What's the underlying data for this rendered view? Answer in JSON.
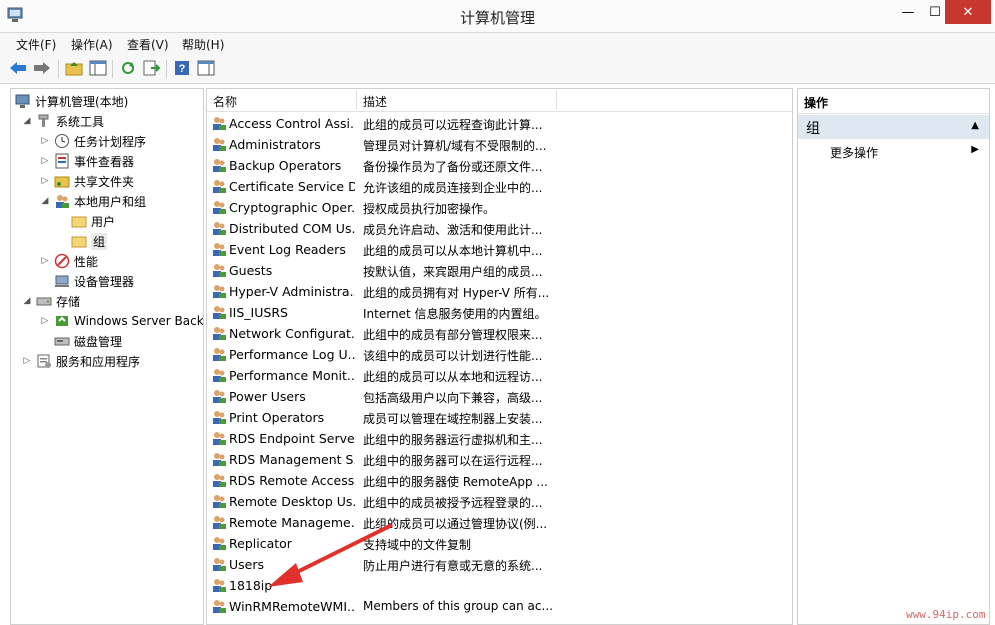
{
  "window": {
    "title": "计算机管理",
    "min_glyph": "—",
    "max_glyph": "☐",
    "close_glyph": "✕"
  },
  "menu": [
    {
      "label": "文件(F)"
    },
    {
      "label": "操作(A)"
    },
    {
      "label": "查看(V)"
    },
    {
      "label": "帮助(H)"
    }
  ],
  "tree": {
    "root": "计算机管理(本地)",
    "system_tools": "系统工具",
    "task_scheduler": "任务计划程序",
    "event_viewer": "事件查看器",
    "shared_folders": "共享文件夹",
    "local_users_groups": "本地用户和组",
    "users": "用户",
    "groups": "组",
    "performance": "性能",
    "device_manager": "设备管理器",
    "storage": "存储",
    "windows_server_backup": "Windows Server Back",
    "disk_management": "磁盘管理",
    "services_apps": "服务和应用程序"
  },
  "list": {
    "col_name": "名称",
    "col_desc": "描述",
    "rows": [
      {
        "name": "Access Control Assi...",
        "desc": "此组的成员可以远程查询此计算..."
      },
      {
        "name": "Administrators",
        "desc": "管理员对计算机/域有不受限制的..."
      },
      {
        "name": "Backup Operators",
        "desc": "备份操作员为了备份或还原文件..."
      },
      {
        "name": "Certificate Service D...",
        "desc": "允许该组的成员连接到企业中的..."
      },
      {
        "name": "Cryptographic Oper...",
        "desc": "授权成员执行加密操作。"
      },
      {
        "name": "Distributed COM Us...",
        "desc": "成员允许启动、激活和使用此计..."
      },
      {
        "name": "Event Log Readers",
        "desc": "此组的成员可以从本地计算机中..."
      },
      {
        "name": "Guests",
        "desc": "按默认值，来宾跟用户组的成员..."
      },
      {
        "name": "Hyper-V Administra...",
        "desc": "此组的成员拥有对 Hyper-V 所有..."
      },
      {
        "name": "IIS_IUSRS",
        "desc": "Internet 信息服务使用的内置组。"
      },
      {
        "name": "Network Configurat...",
        "desc": "此组中的成员有部分管理权限来..."
      },
      {
        "name": "Performance Log U...",
        "desc": "该组中的成员可以计划进行性能..."
      },
      {
        "name": "Performance Monit...",
        "desc": "此组的成员可以从本地和远程访..."
      },
      {
        "name": "Power Users",
        "desc": "包括高级用户以向下兼容，高级..."
      },
      {
        "name": "Print Operators",
        "desc": "成员可以管理在域控制器上安装..."
      },
      {
        "name": "RDS Endpoint Serve...",
        "desc": "此组中的服务器运行虚拟机和主..."
      },
      {
        "name": "RDS Management S...",
        "desc": "此组中的服务器可以在运行远程..."
      },
      {
        "name": "RDS Remote Access...",
        "desc": "此组中的服务器使 RemoteApp ..."
      },
      {
        "name": "Remote Desktop Us...",
        "desc": "此组中的成员被授予远程登录的..."
      },
      {
        "name": "Remote Manageme...",
        "desc": "此组的成员可以通过管理协议(例..."
      },
      {
        "name": "Replicator",
        "desc": "支持域中的文件复制"
      },
      {
        "name": "Users",
        "desc": "防止用户进行有意或无意的系统..."
      },
      {
        "name": "1818ip",
        "desc": ""
      },
      {
        "name": "WinRMRemoteWMI...",
        "desc": "Members of this group can ac..."
      }
    ]
  },
  "actions": {
    "title": "操作",
    "section": "组",
    "more": "更多操作",
    "section_arrow": "▲",
    "more_arrow": "▶"
  },
  "watermark": "www.94ip.com",
  "colors": {
    "annotation_arrow": "#e0312d",
    "close_button": "#c7372c",
    "selection": "#dfe8f1"
  }
}
